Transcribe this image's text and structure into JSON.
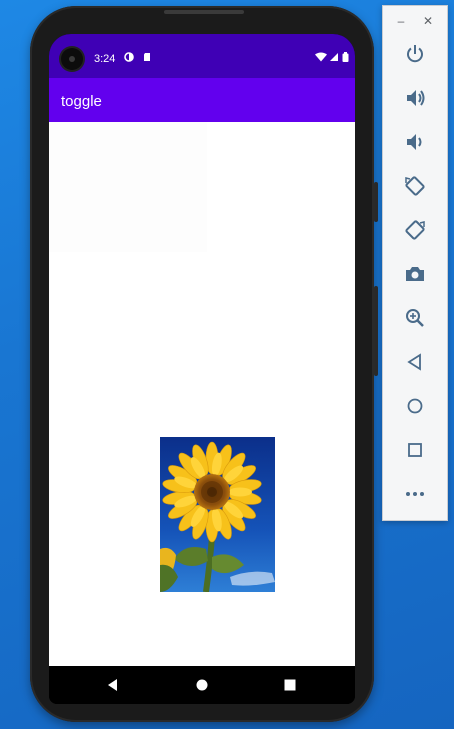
{
  "status_bar": {
    "time": "3:24"
  },
  "app_bar": {
    "title": "toggle"
  },
  "emulator": {
    "window_controls": {
      "minimize": "–",
      "close": "✕"
    },
    "buttons": [
      "power-icon",
      "volume-up-icon",
      "volume-down-icon",
      "rotate-left-icon",
      "rotate-right-icon",
      "camera-icon",
      "zoom-icon",
      "back-icon",
      "home-icon",
      "overview-icon",
      "more-icon"
    ]
  },
  "colors": {
    "status_bar": "#3f00b5",
    "app_bar": "#6200ee",
    "desktop": "#1976d2"
  }
}
